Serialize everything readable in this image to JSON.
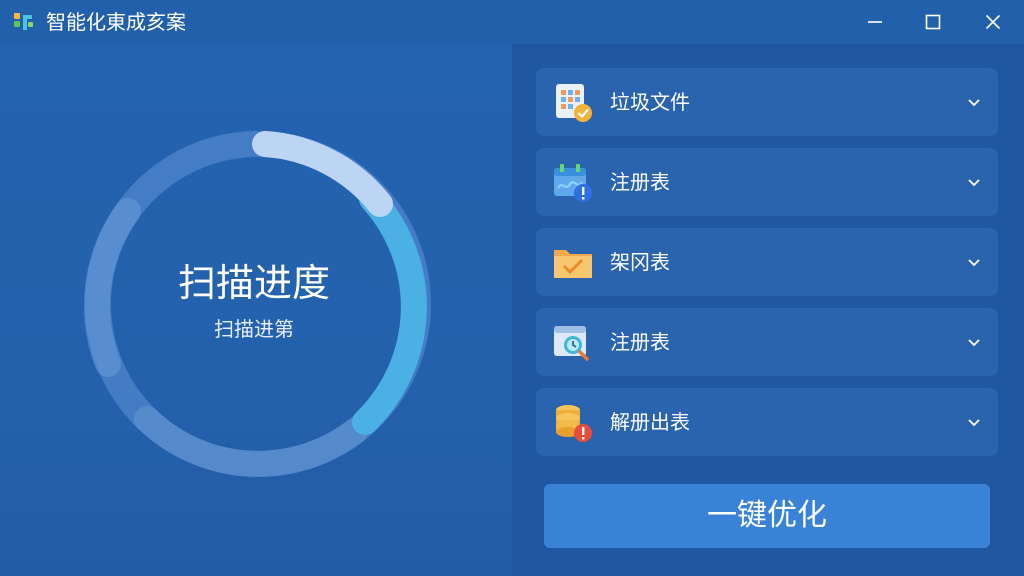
{
  "app": {
    "title": "智能化東成亥案",
    "logo_icon": "app-logo-icon"
  },
  "window_controls": {
    "minimize_icon": "minimize-icon",
    "maximize_icon": "maximize-icon",
    "close_icon": "close-icon"
  },
  "scan": {
    "title": "扫描进度",
    "subtitle": "扫描进第"
  },
  "items": [
    {
      "label": "垃圾文件",
      "icon": "file-grid-check-icon"
    },
    {
      "label": "注册表",
      "icon": "calendar-alert-icon"
    },
    {
      "label": "架冈表",
      "icon": "folder-check-icon"
    },
    {
      "label": "注册表",
      "icon": "clock-search-icon"
    },
    {
      "label": "解册出表",
      "icon": "database-alert-icon"
    }
  ],
  "optimize_button": {
    "label": "一键优化"
  },
  "colors": {
    "background": "#245da8",
    "right_panel": "#1f57a0",
    "item_bg": "#2a64af",
    "button": "#3a82d8",
    "ring_track": "#5b8fd0",
    "ring_progress_light": "#b9d3f3",
    "ring_progress_cyan": "#4bb0e3"
  }
}
